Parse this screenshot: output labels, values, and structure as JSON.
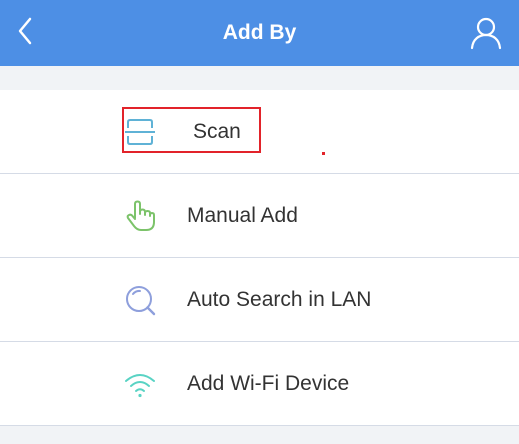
{
  "header": {
    "title": "Add By",
    "back_icon": "chevron-left-icon",
    "user_icon": "user-icon",
    "background_color": "#4d8fe5"
  },
  "menu": {
    "items": [
      {
        "label": "Scan",
        "icon": "scan-icon",
        "icon_color": "#5fb2d6",
        "highlighted": true
      },
      {
        "label": "Manual Add",
        "icon": "hand-pointer-icon",
        "icon_color": "#7cc36a"
      },
      {
        "label": "Auto Search in LAN",
        "icon": "search-icon",
        "icon_color": "#8e9fdc"
      },
      {
        "label": "Add Wi-Fi Device",
        "icon": "wifi-icon",
        "icon_color": "#59d3c4"
      }
    ]
  },
  "highlight_color": "#e2232a"
}
